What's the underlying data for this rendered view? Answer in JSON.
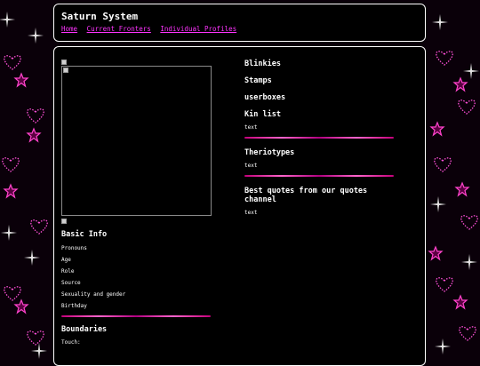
{
  "header": {
    "title": "Saturn System",
    "nav": [
      {
        "label": "Home"
      },
      {
        "label": "Current Fronters"
      },
      {
        "label": "Individual Profiles"
      }
    ]
  },
  "left": {
    "basic_info_title": "Basic Info",
    "fields": [
      "Pronouns",
      "Age",
      "Role",
      "Source",
      "Sexuality and gender",
      "Birthday"
    ],
    "boundaries_title": "Boundaries",
    "boundaries_first": "Touch:"
  },
  "right": {
    "sections": [
      {
        "title": "Blinkies"
      },
      {
        "title": "Stamps"
      },
      {
        "title": "userboxes"
      },
      {
        "title": "Kin list",
        "text": "text"
      },
      {
        "title": "Theriotypes",
        "text": "text"
      },
      {
        "title": "Best quotes from our quotes channel",
        "text": "text"
      }
    ]
  },
  "colors": {
    "background": "#0a0009",
    "panel": "#000000",
    "border": "#ffffff",
    "link": "#ff33ff",
    "accent": "#ff66cc"
  },
  "icons": [
    "heart-icon",
    "star-icon",
    "sparkle-icon",
    "broken-image-icon"
  ]
}
